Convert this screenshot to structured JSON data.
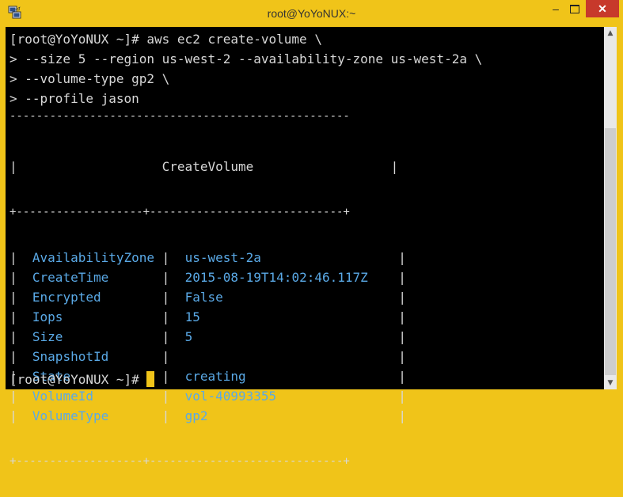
{
  "window": {
    "title": "root@YoYoNUX:~",
    "minimize_label": "–",
    "close_label": "✕"
  },
  "terminal": {
    "lines": [
      "[root@YoYoNUX ~]# aws ec2 create-volume \\",
      "> --size 5 --region us-west-2 --availability-zone us-west-2a \\",
      "> --volume-type gp2 \\",
      "> --profile jason",
      "---------------------------------------------------"
    ],
    "table": {
      "header_row": "|                   CreateVolume                  |",
      "separator": "+-------------------+-----------------------------+",
      "bottom": "+-------------------+-----------------------------+",
      "rows": [
        {
          "key": "AvailabilityZone",
          "value": "us-west-2a"
        },
        {
          "key": "CreateTime",
          "value": "2015-08-19T14:02:46.117Z"
        },
        {
          "key": "Encrypted",
          "value": "False"
        },
        {
          "key": "Iops",
          "value": "15"
        },
        {
          "key": "Size",
          "value": "5"
        },
        {
          "key": "SnapshotId",
          "value": ""
        },
        {
          "key": "State",
          "value": "creating"
        },
        {
          "key": "VolumeId",
          "value": "vol-40993355"
        },
        {
          "key": "VolumeType",
          "value": "gp2"
        }
      ]
    },
    "prompt": "[root@YoYoNUX ~]# "
  },
  "colors": {
    "frame": "#f0c419",
    "background": "#000000",
    "text": "#d8d8d8",
    "value_text": "#5aa9e6",
    "cursor": "#f0c419",
    "close_button": "#c7392b"
  },
  "icons": {
    "app": "putty-icon",
    "minimize": "minimize-icon",
    "maximize": "maximize-icon",
    "close": "close-icon"
  }
}
